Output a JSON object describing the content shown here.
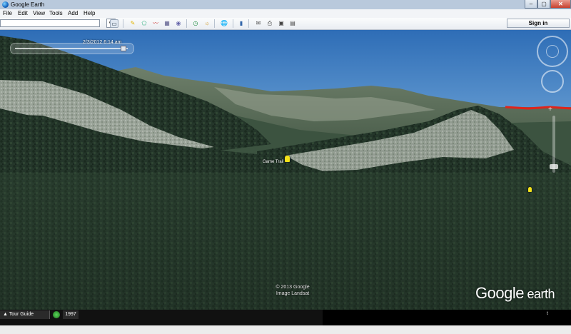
{
  "window": {
    "title": "Google Earth",
    "controls": {
      "minimize": "–",
      "maximize": "▢",
      "close": "✕"
    }
  },
  "menu": [
    "File",
    "Edit",
    "View",
    "Tools",
    "Add",
    "Help"
  ],
  "toolbar": {
    "search_value": "",
    "search_icon": "search-icon",
    "signin_label": "Sign in"
  },
  "viewport": {
    "timestamp": "2/3/2012   6:14 am",
    "placemark_label": "Game Trail",
    "copyright_line1": "© 2013 Google",
    "copyright_line2": "Image Landsat",
    "brand_google": "Google",
    "brand_earth": " earth"
  },
  "statusbar": {
    "tour_label": "Tour Guide",
    "year": "1997",
    "trailing": "t"
  },
  "colors": {
    "sky_top": "#2f6fb8",
    "forest": "#26392a",
    "rock": "#b9c0b5",
    "placemark": "#f5e21a",
    "boundary": "#e0241b"
  }
}
